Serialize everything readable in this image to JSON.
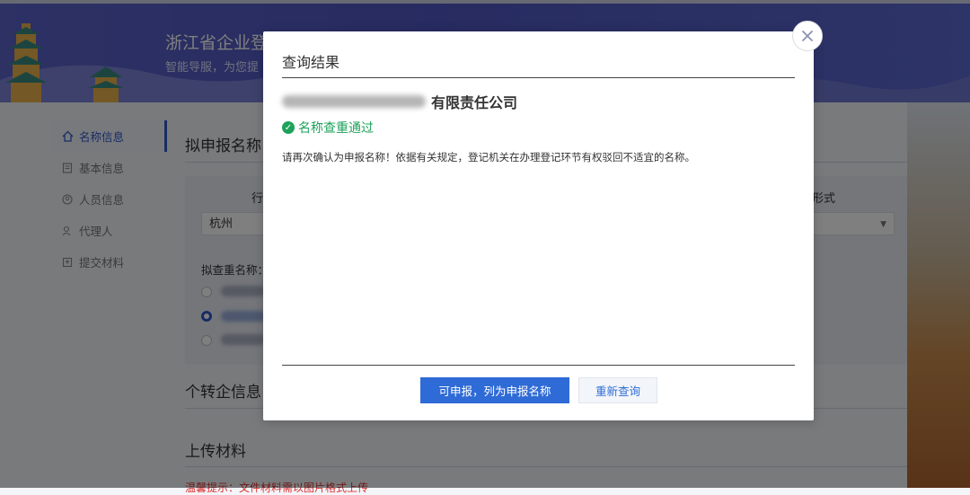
{
  "header": {
    "site_title": "浙江省企业登",
    "site_subtitle": "智能导服，为您提"
  },
  "side_nav": {
    "items": [
      {
        "label": "名称信息",
        "icon": "home-icon",
        "active": true
      },
      {
        "label": "基本信息",
        "icon": "document-icon",
        "active": false
      },
      {
        "label": "人员信息",
        "icon": "person-circle-icon",
        "active": false
      },
      {
        "label": "代理人",
        "icon": "user-icon",
        "active": false
      },
      {
        "label": "提交材料",
        "icon": "upload-box-icon",
        "active": false
      }
    ]
  },
  "main": {
    "section_name": "拟申报名称",
    "city_label_partial": "行",
    "city_value": "杭州",
    "form_label_partial": "形式",
    "check_label": "拟查重名称：",
    "section_convert": "个转企信息",
    "section_upload": "上传材料",
    "warning": "温馨提示：文件材料需以图片格式上传"
  },
  "modal": {
    "title": "查询结果",
    "company_suffix": "有限责任公司",
    "status_text": "名称查重通过",
    "notice": "请再次确认为申报名称！依据有关规定，登记机关在办理登记环节有权驳回不适宜的名称。",
    "primary_button": "可申报，列为申报名称",
    "secondary_button": "重新查询"
  },
  "colors": {
    "header": "#5a62c8",
    "primary": "#2f6bd6",
    "success": "#1ea25a"
  }
}
